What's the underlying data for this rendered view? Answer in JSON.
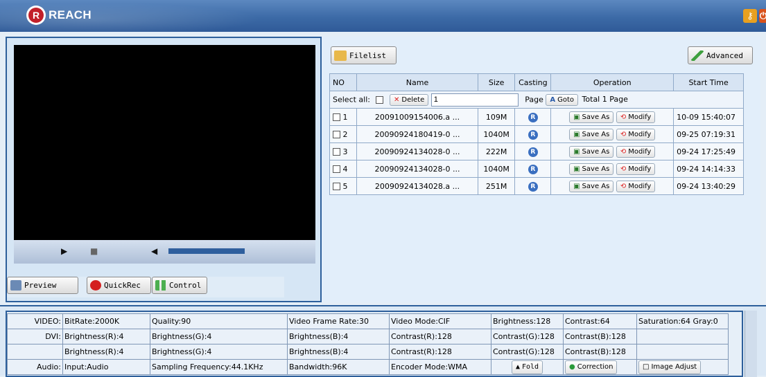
{
  "header": {
    "logo_text": "REACH",
    "logo_letter": "R"
  },
  "player": {
    "play_icon": "▶",
    "stop_icon": "■",
    "volume_icon": "◀"
  },
  "buttons": {
    "preview": "Preview",
    "quickrec": "QuickRec",
    "control": "Control",
    "filelist": "Filelist",
    "advanced": "Advanced"
  },
  "filelist": {
    "columns": [
      "NO",
      "Name",
      "Size",
      "Casting",
      "Operation",
      "Start Time"
    ],
    "select_all": "Select all:",
    "delete": "Delete",
    "page_value": "1",
    "page_label": "Page",
    "goto": "Goto",
    "total": "Total 1  Page",
    "save_as": "Save As",
    "modify": "Modify",
    "rows": [
      {
        "no": "1",
        "name": "20091009154006.a ...",
        "size": "109M",
        "time": "10-09 15:40:07"
      },
      {
        "no": "2",
        "name": "20090924180419-0 ...",
        "size": "1040M",
        "time": "09-25 07:19:31"
      },
      {
        "no": "3",
        "name": "20090924134028-0 ...",
        "size": "222M",
        "time": "09-24 17:25:49"
      },
      {
        "no": "4",
        "name": "20090924134028-0 ...",
        "size": "1040M",
        "time": "09-24 14:14:33"
      },
      {
        "no": "5",
        "name": "20090924134028.a ...",
        "size": "251M",
        "time": "09-24 13:40:29"
      }
    ]
  },
  "info": {
    "r1": [
      "VIDEO:",
      "BitRate:2000K",
      "Quality:90",
      "Video Frame Rate:30",
      "Video Mode:CIF",
      "Brightness:128",
      "Contrast:64",
      "Saturation:64  Gray:0"
    ],
    "r2": [
      "DVI:",
      "Brightness(R):4",
      "Brightness(G):4",
      "Brightness(B):4",
      "Contrast(R):128",
      "Contrast(G):128",
      "Contrast(B):128",
      ""
    ],
    "r3": [
      "",
      "Brightness(R):4",
      "Brightness(G):4",
      "Brightness(B):4",
      "Contrast(R):128",
      "Contrast(G):128",
      "Contrast(B):128",
      ""
    ],
    "r4": [
      "Audio:",
      "Input:Audio",
      "Sampling Frequency:44.1KHz",
      "Bandwidth:96K",
      "Encoder Mode:WMA",
      "Fold",
      "Correction",
      "Image Adjust"
    ]
  },
  "colors": {
    "brand": "#c2202a",
    "accent": "#2d5f9b"
  }
}
